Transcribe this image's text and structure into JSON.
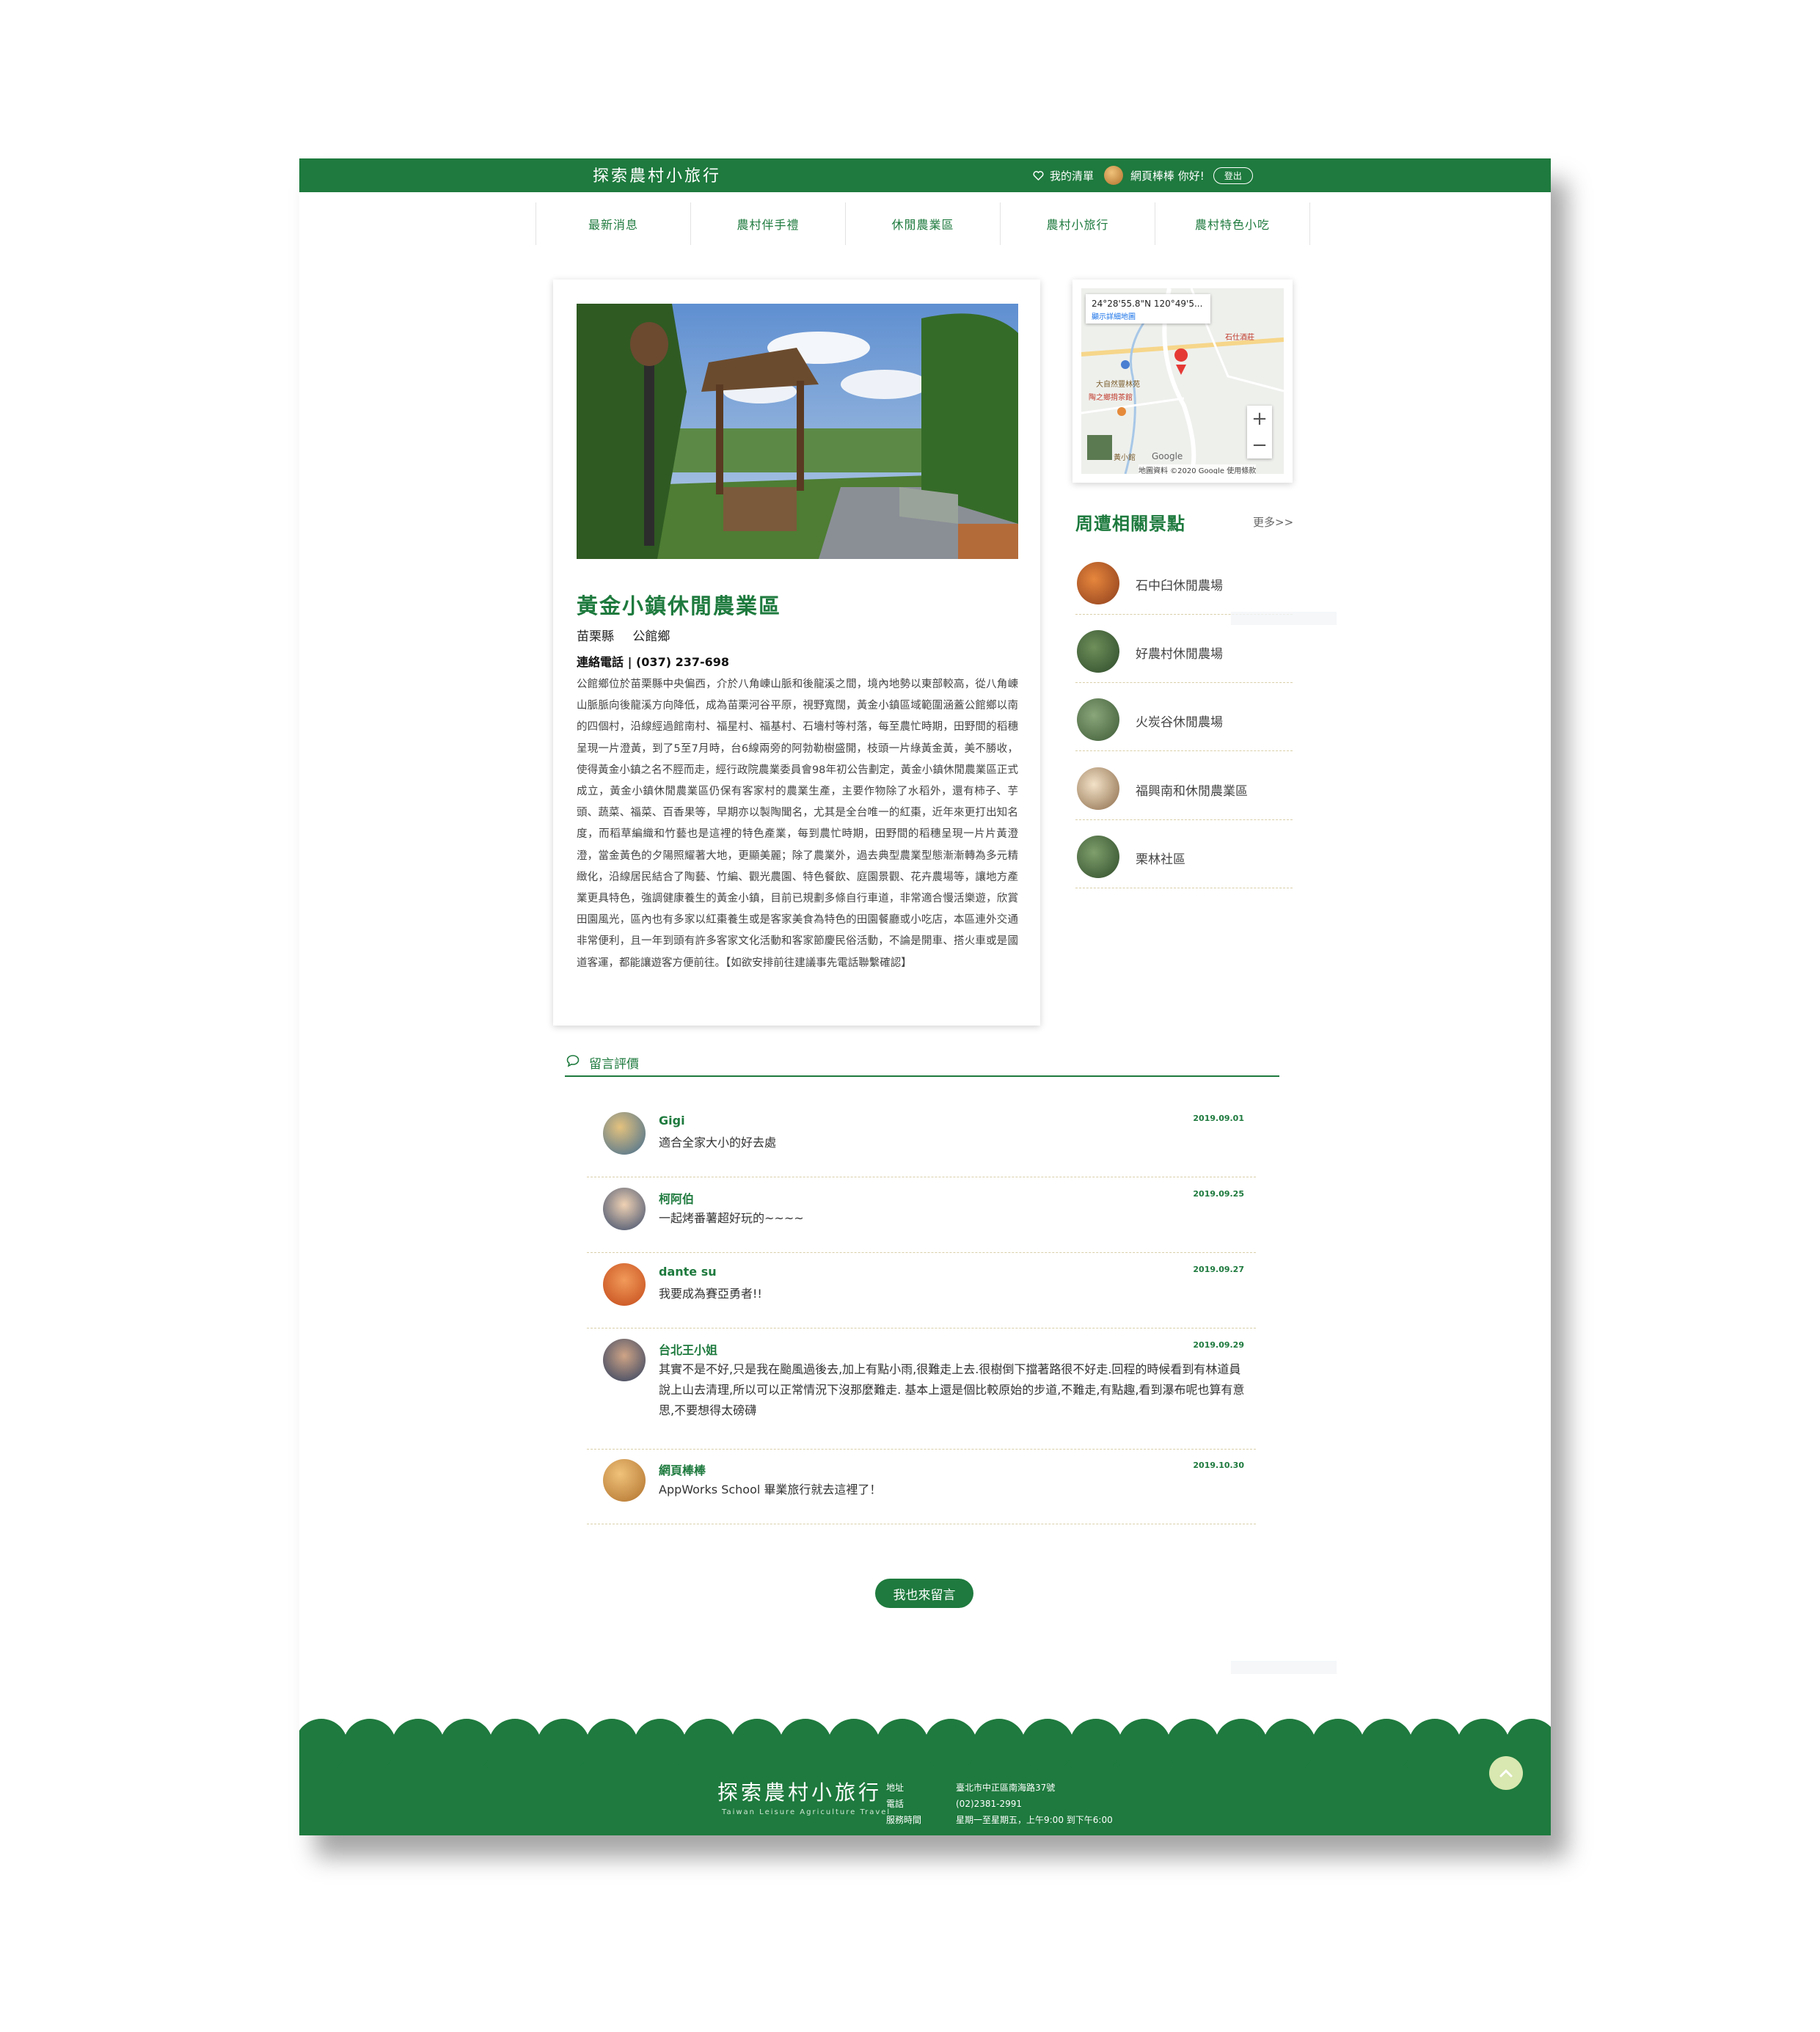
{
  "header": {
    "logo": "探索農村小旅行",
    "wishlist_label": "我的清單",
    "user_greeting": "網頁棒棒 你好!",
    "logout_label": "登出"
  },
  "nav": {
    "items": [
      {
        "label": "最新消息"
      },
      {
        "label": "農村伴手禮"
      },
      {
        "label": "休閒農業區"
      },
      {
        "label": "農村小旅行"
      },
      {
        "label": "農村特色小吃"
      }
    ]
  },
  "farm": {
    "title": "黃金小鎮休閒農業區",
    "county": "苗栗縣",
    "township": "公館鄉",
    "phone": "連絡電話 | (037) 237-698",
    "description": "公館鄉位於苗栗縣中央偏西，介於八角崠山脈和後龍溪之間，境內地勢以東部較高，從八角崠山脈脈向後龍溪方向降低，成為苗栗河谷平原，視野寬闊，黃金小鎮區域範圍涵蓋公館鄉以南的四個村，沿線經過館南村、福星村、福基村、石墻村等村落，每至農忙時期，田野間的稻穗呈現一片澄黃，到了5至7月時，台6線兩旁的阿勃勒樹盛開，枝頭一片綠黃金黃，美不勝收，使得黃金小鎮之名不脛而走，經行政院農業委員會98年初公告劃定，黃金小鎮休閒農業區正式成立，黃金小鎮休閒農業區仍保有客家村的農業生產，主要作物除了水稻外，還有柿子、芋頭、蔬菜、福菜、百香果等，早期亦以製陶聞名，尤其是全台唯一的紅棗，近年來更打出知名度，而稻草編織和竹藝也是這裡的特色產業，每到農忙時期，田野間的稻穗呈現一片片黃澄澄，當金黃色的夕陽照耀著大地，更顯美麗；除了農業外，過去典型農業型態漸漸轉為多元精緻化，沿線居民結合了陶藝、竹編、觀光農園、特色餐飲、庭園景觀、花卉農場等，讓地方產業更具特色，強調健康養生的黃金小鎮，目前已規劃多條自行車道，非常適合慢活樂遊，欣賞田園風光，區內也有多家以紅棗養生或是客家美食為特色的田園餐廳或小吃店，本區連外交通非常便利，且一年到頭有許多客家文化活動和客家節慶民俗活動，不論是開車、搭火車或是國道客運，都能讓遊客方便前往。【如欲安排前往建議事先電話聯繫確認】"
  },
  "map": {
    "coords": "24°28'55.8\"N 120°49'5...",
    "link": "顯示詳細地圖",
    "labels": [
      "大自然豐林苑",
      "陶之鄉揹茶館",
      "石仕酒莊",
      "黃小館"
    ],
    "google": "Google",
    "credit": "地圖資料 ©2020 Google   使用條款",
    "zoom_in": "+",
    "zoom_out": "−"
  },
  "related": {
    "heading": "周遭相關景點",
    "more": "更多>>",
    "items": [
      {
        "name": "石中臼休閒農場"
      },
      {
        "name": "好農村休閒農場"
      },
      {
        "name": "火炭谷休閒農場"
      },
      {
        "name": "福興南和休閒農業區"
      },
      {
        "name": "栗林社區"
      }
    ]
  },
  "comments": {
    "heading": "留言評價",
    "items": [
      {
        "name": "Gigi",
        "date": "2019.09.01",
        "text": "適合全家大小的好去處"
      },
      {
        "name": "柯阿伯",
        "date": "2019.09.25",
        "text": "一起烤番薯超好玩的~~~~"
      },
      {
        "name": "dante su",
        "date": "2019.09.27",
        "text": "我要成為賽亞勇者!!"
      },
      {
        "name": "台北王小姐",
        "date": "2019.09.29",
        "text": "其實不是不好,只是我在颱風過後去,加上有點小雨,很難走上去.很樹倒下擋著路很不好走.回程的時候看到有林道員說上山去清理,所以可以正常情況下沒那麼難走. 基本上還是個比較原始的步道,不難走,有點趣,看到瀑布呢也算有意思,不要想得太磅礴"
      },
      {
        "name": "網頁棒棒",
        "date": "2019.10.30",
        "text": "AppWorks School 畢業旅行就去這裡了！"
      }
    ],
    "leave_button": "我也來留言"
  },
  "footer": {
    "logo": "探索農村小旅行",
    "subtitle": "Taiwan Leisure Agriculture Travel",
    "address_label": "地址",
    "phone_label": "電話",
    "hours_label": "服務時間",
    "address": "臺北市中正區南海路37號",
    "phone": "(02)2381-2991",
    "hours": "星期一至星期五，上午9:00 到下午6:00"
  },
  "colors": {
    "brand_green": "#1e7a3e",
    "divider": "#d9cfa9",
    "totop": "#d9e7b0"
  }
}
